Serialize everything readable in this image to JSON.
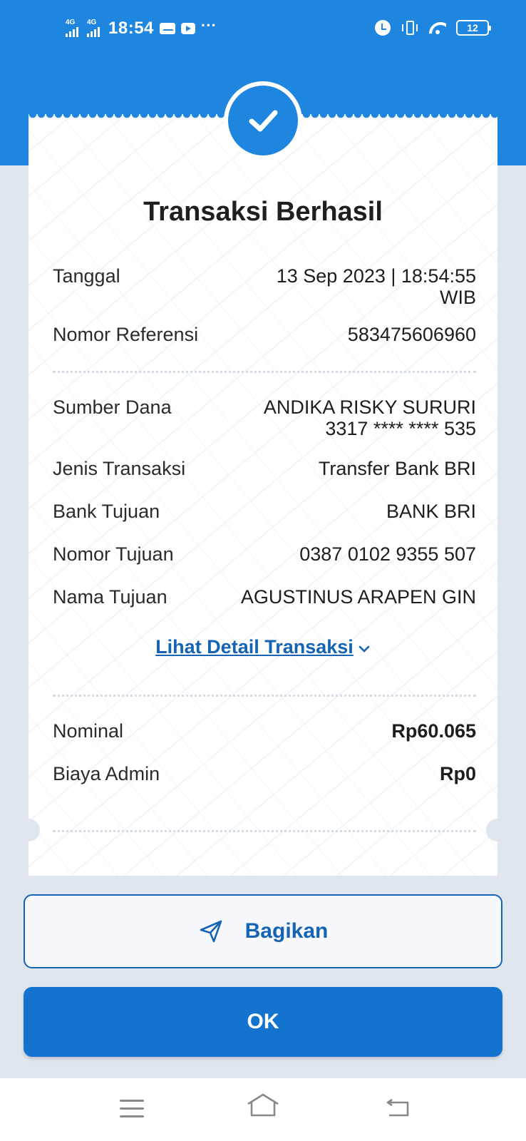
{
  "status_bar": {
    "network_1": "4G",
    "network_2": "4G",
    "time": "18:54",
    "more": "···",
    "battery": "12"
  },
  "receipt": {
    "title": "Transaksi Berhasil",
    "rows_top": [
      {
        "label": "Tanggal",
        "value_line1": "13 Sep 2023 | 18:54:55",
        "value_line2": "WIB"
      },
      {
        "label": "Nomor Referensi",
        "value_line1": "583475606960"
      }
    ],
    "rows_mid": [
      {
        "label": "Sumber Dana",
        "value_line1": "ANDIKA RISKY SURURI",
        "value_line2": "3317 **** **** 535"
      },
      {
        "label": "Jenis Transaksi",
        "value_line1": "Transfer Bank BRI"
      },
      {
        "label": "Bank Tujuan",
        "value_line1": "BANK BRI"
      },
      {
        "label": "Nomor Tujuan",
        "value_line1": "0387 0102 9355 507"
      },
      {
        "label": "Nama Tujuan",
        "value_line1": "AGUSTINUS ARAPEN GIN"
      }
    ],
    "detail_link": "Lihat Detail Transaksi",
    "rows_bottom": [
      {
        "label": "Nominal",
        "value_line1": "Rp60.065"
      },
      {
        "label": "Biaya Admin",
        "value_line1": "Rp0"
      }
    ]
  },
  "actions": {
    "share_label": "Bagikan",
    "ok_label": "OK"
  },
  "colors": {
    "brand_blue": "#1f86e0",
    "button_blue": "#1373cf",
    "link_blue": "#1563b4",
    "background": "#dfe6ee"
  }
}
